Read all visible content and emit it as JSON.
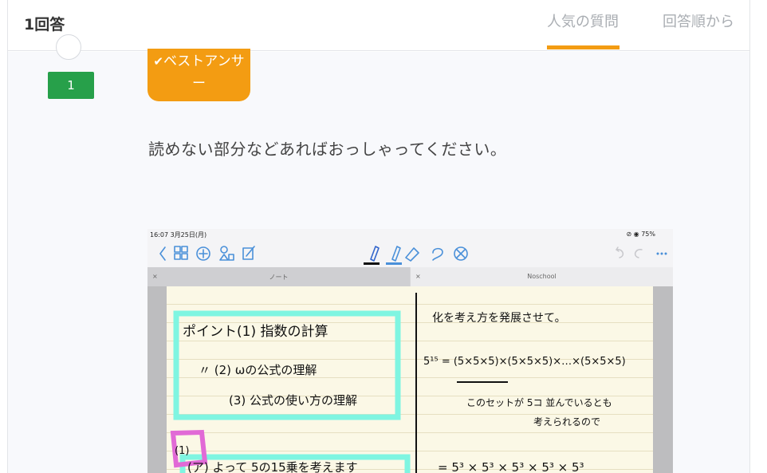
{
  "header": {
    "answer_count": "1回答",
    "tabs": [
      {
        "label": "人気の質問",
        "active": true
      },
      {
        "label": "回答順から",
        "active": false
      }
    ]
  },
  "answer": {
    "votes": "1",
    "best_answer_line1": "ベストアンサ",
    "best_answer_line2": "ー",
    "text": "読めない部分などあればおっしゃってください。"
  },
  "image": {
    "status_time": "16:07  3月25日(月)",
    "status_battery": "⊘ ◉ 75%",
    "tab_left": "ノート",
    "tab_right": "Noschool",
    "tab_close": "×",
    "notes_left": [
      "ポイント(1)  指数の計算",
      "〃  (2)  ωの公式の理解",
      "(3)  公式の使い方の理解",
      "(1)",
      "(ア)  よって  5の15乗を考えます"
    ],
    "notes_right": [
      "化を考え方を発展させて。",
      "5¹⁵ = (5×5×5)×(5×5×5)×…×(5×5×5)",
      "このセットが 5コ 並んでいるとも",
      "考えられるので",
      "= 5³ × 5³ × 5³ × 5³ × 5³"
    ]
  },
  "colors": {
    "accent_orange": "#f39c12",
    "vote_green": "#27a04a",
    "highlight_cyan": "#7ff5e1",
    "highlight_pink": "#e16ad6"
  }
}
